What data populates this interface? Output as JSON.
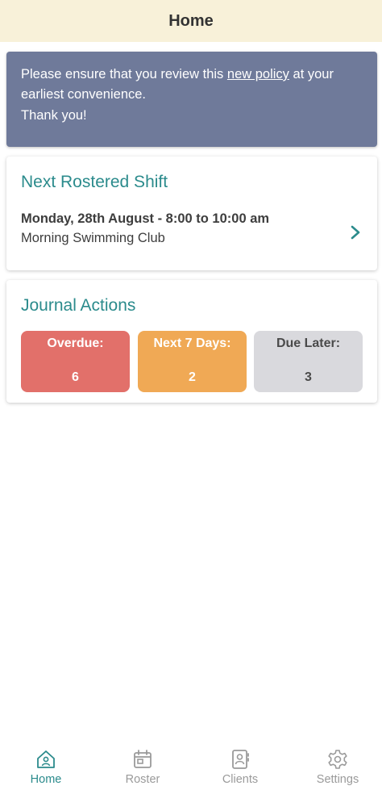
{
  "header": {
    "title": "Home"
  },
  "notice": {
    "text_before": "Please ensure that you review this ",
    "link_text": "new policy",
    "text_after": " at your earliest convenience.",
    "thanks": "Thank you!"
  },
  "shift": {
    "title": "Next Rostered Shift",
    "when": "Monday, 28th August - 8:00 to 10:00 am",
    "name": "Morning Swimming Club",
    "chevron_icon": "chevron-right-icon"
  },
  "journal": {
    "title": "Journal Actions",
    "tiles": [
      {
        "label": "Overdue:",
        "count": "6",
        "color": "#e2706a"
      },
      {
        "label": "Next 7 Days:",
        "count": "2",
        "color": "#f0a955"
      },
      {
        "label": "Due Later:",
        "count": "3",
        "color": "#d9d9dd"
      }
    ]
  },
  "nav": {
    "items": [
      {
        "label": "Home",
        "icon": "home-icon",
        "active": true
      },
      {
        "label": "Roster",
        "icon": "calendar-icon",
        "active": false
      },
      {
        "label": "Clients",
        "icon": "contact-book-icon",
        "active": false
      },
      {
        "label": "Settings",
        "icon": "gear-icon",
        "active": false
      }
    ]
  },
  "colors": {
    "header_bg": "#f8f1d9",
    "notice_bg": "#6f7a9a",
    "accent": "#2b8b8c",
    "inactive": "#9a9a9a"
  }
}
